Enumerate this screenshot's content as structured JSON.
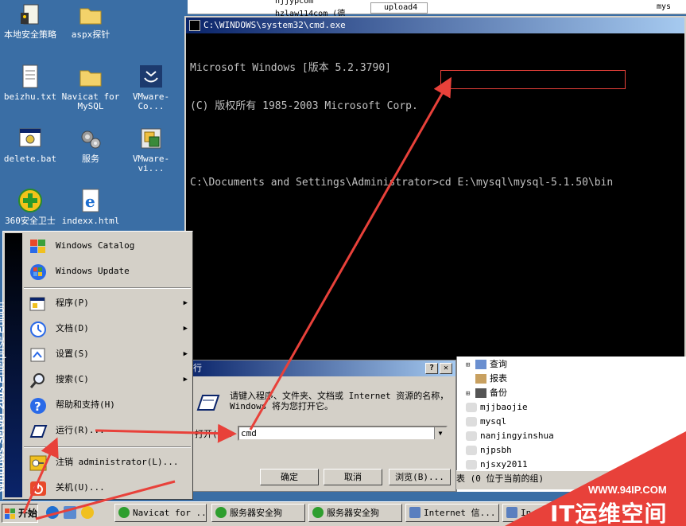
{
  "top_strip": {
    "items": [
      "njjypcom",
      "hzlaw114com (德",
      "upload4",
      "mys"
    ]
  },
  "desktop_icons": [
    {
      "label": "本地安全策略",
      "icon": "security-policy-icon"
    },
    {
      "label": "aspx探针",
      "icon": "folder-icon"
    },
    {
      "label": "beizhu.txt",
      "icon": "text-file-icon"
    },
    {
      "label": "Navicat for MySQL",
      "icon": "folder-icon"
    },
    {
      "label": "VMware-Co...",
      "icon": "vmware-icon"
    },
    {
      "label": "delete.bat",
      "icon": "batch-file-icon"
    },
    {
      "label": "服务",
      "icon": "services-icon"
    },
    {
      "label": "VMware-vi...",
      "icon": "vmware-installer-icon"
    },
    {
      "label": "360安全卫士",
      "icon": "shield-plus-icon"
    },
    {
      "label": "indexx.html",
      "icon": "ie-html-icon"
    }
  ],
  "cmd": {
    "title": "C:\\WINDOWS\\system32\\cmd.exe",
    "lines": [
      "Microsoft Windows [版本 5.2.3790]",
      "(C) 版权所有 1985-2003 Microsoft Corp.",
      "",
      "C:\\Documents and Settings\\Administrator>cd E:\\mysql\\mysql-5.1.50\\bin"
    ]
  },
  "run_dialog": {
    "title": "行",
    "help_btn": "?",
    "close_btn": "✕",
    "description": "请键入程序、文件夹、文档或 Internet 资源的名称，Windows 将为您打开它。",
    "open_label": "打开(O):",
    "input_value": "cmd",
    "ok": "确定",
    "cancel": "取消",
    "browse": "浏览(B)..."
  },
  "right_panel": {
    "tree": [
      {
        "mark": "⊞",
        "label": "查询",
        "icon": "query-icon"
      },
      {
        "mark": "",
        "label": "报表",
        "icon": "report-icon"
      },
      {
        "mark": "⊞",
        "label": "备份",
        "icon": "backup-icon"
      },
      {
        "mark": "",
        "label": "mjjbaojie",
        "icon": "database-icon"
      },
      {
        "mark": "",
        "label": "mysql",
        "icon": "database-icon"
      },
      {
        "mark": "",
        "label": "nanjingyinshua",
        "icon": "database-icon"
      },
      {
        "mark": "",
        "label": "njpsbh",
        "icon": "database-icon"
      },
      {
        "mark": "",
        "label": "njsxy2011",
        "icon": "database-icon"
      }
    ],
    "status": "表 (0 位于当前的组)"
  },
  "start_menu": {
    "band_text_1": "Windows Server 2003",
    "band_text_2": " Enterprise Edition",
    "items": [
      {
        "label": "Windows Catalog",
        "icon": "windows-catalog-icon",
        "submenu": false
      },
      {
        "label": "Windows Update",
        "icon": "windows-update-icon",
        "submenu": false
      },
      {
        "label": "程序(P)",
        "icon": "programs-icon",
        "submenu": true
      },
      {
        "label": "文档(D)",
        "icon": "documents-icon",
        "submenu": true
      },
      {
        "label": "设置(S)",
        "icon": "settings-icon",
        "submenu": true
      },
      {
        "label": "搜索(C)",
        "icon": "search-icon",
        "submenu": true
      },
      {
        "label": "帮助和支持(H)",
        "icon": "help-icon",
        "submenu": false
      },
      {
        "label": "运行(R)...",
        "icon": "run-icon",
        "submenu": false
      },
      {
        "label": "注销 administrator(L)...",
        "icon": "logoff-icon",
        "submenu": false
      },
      {
        "label": "关机(U)...",
        "icon": "shutdown-icon",
        "submenu": false
      }
    ]
  },
  "taskbar": {
    "start_label": "开始",
    "tasks": [
      {
        "label": "Navicat for ...",
        "color": "#2e9e2e"
      },
      {
        "label": "服务器安全狗",
        "color": "#2e9e2e"
      },
      {
        "label": "服务器安全狗",
        "color": "#2e9e2e"
      },
      {
        "label": "Internet 信...",
        "color": "#5a7fbf"
      },
      {
        "label": "In",
        "color": "#5a7fbf"
      }
    ]
  },
  "watermark": {
    "url": "WWW.94IP.COM",
    "name": "IT运维空间"
  },
  "colors": {
    "desktop": "#3a6ea5",
    "annotation_red": "#e8413a"
  }
}
